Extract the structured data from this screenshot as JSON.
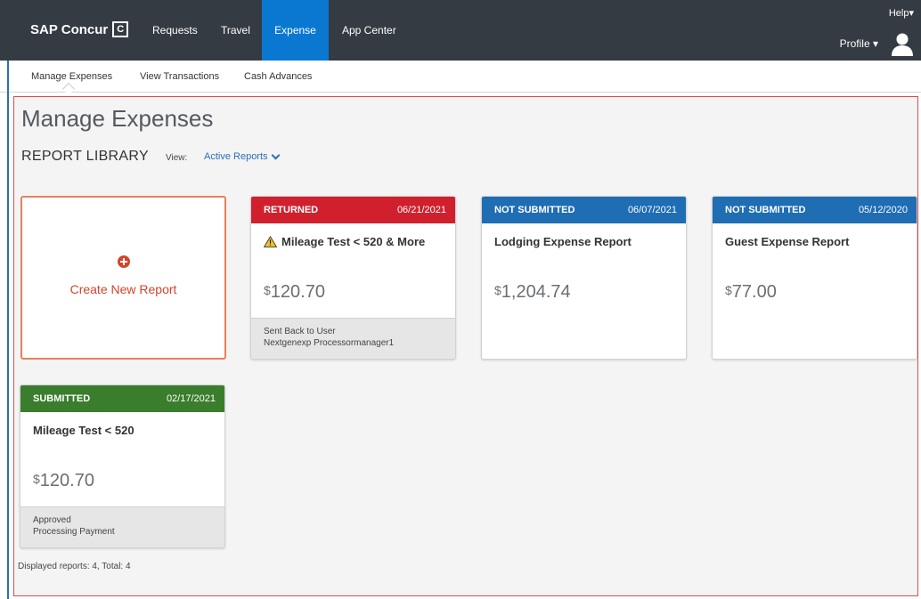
{
  "header": {
    "brand": "SAP Concur",
    "brand_mark": "C",
    "nav": [
      {
        "label": "Requests"
      },
      {
        "label": "Travel"
      },
      {
        "label": "Expense",
        "active": true
      },
      {
        "label": "App Center"
      }
    ],
    "help": "Help▾",
    "profile": "Profile ▾"
  },
  "subnav": {
    "items": [
      {
        "label": "Manage Expenses"
      },
      {
        "label": "View Transactions"
      },
      {
        "label": "Cash Advances"
      }
    ]
  },
  "main": {
    "title": "Manage Expenses",
    "library_label": "REPORT LIBRARY",
    "view_label": "View:",
    "view_value": "Active Reports",
    "create_label": "Create New Report",
    "reports": [
      {
        "status": "RETURNED",
        "date": "06/21/2021",
        "name": "Mileage Test < 520 & More",
        "currency": "$",
        "amount": "120.70",
        "footer_line1": "Sent Back to User",
        "footer_line2": "Nextgenexp Processormanager1",
        "color": "#d0202e"
      },
      {
        "status": "NOT SUBMITTED",
        "date": "06/07/2021",
        "name": "Lodging Expense Report",
        "currency": "$",
        "amount": "1,204.74",
        "color": "#1f6db3"
      },
      {
        "status": "NOT SUBMITTED",
        "date": "05/12/2020",
        "name": "Guest Expense Report",
        "currency": "$",
        "amount": "77.00",
        "color": "#1f6db3"
      },
      {
        "status": "SUBMITTED",
        "date": "02/17/2021",
        "name": "Mileage Test < 520",
        "currency": "$",
        "amount": "120.70",
        "footer_line1": "Approved",
        "footer_line2": "Processing Payment",
        "color": "#3a7d2c"
      }
    ],
    "count_text": "Displayed reports: 4, Total: 4"
  },
  "colors": {
    "topbar": "#343b42",
    "active_nav": "#0a78d1",
    "accent": "#d4442a"
  }
}
